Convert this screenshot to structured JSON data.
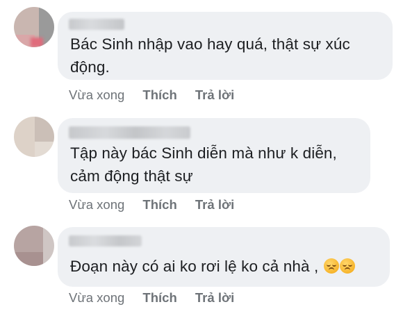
{
  "comments": [
    {
      "text": "Bác Sinh nhập vao hay quá, thật sự xúc\nđộng.",
      "actions": {
        "time": "Vừa xong",
        "like": "Thích",
        "reply": "Trả lời"
      }
    },
    {
      "text": "Tập này bác Sinh diễn mà như k diễn,\ncảm động thật sự",
      "actions": {
        "time": "Vừa xong",
        "like": "Thích",
        "reply": "Trả lời"
      }
    },
    {
      "text": "Đoạn này có ai ko rơi lệ ko cả nhà ,",
      "emojis": [
        "pensive-face",
        "pensive-face"
      ],
      "actions": {
        "time": "Vừa xong",
        "like": "Thích",
        "reply": "Trả lời"
      }
    }
  ],
  "colors": {
    "bubble": "#eef0f3",
    "text": "#1c1e21",
    "meta": "#6e7378"
  }
}
